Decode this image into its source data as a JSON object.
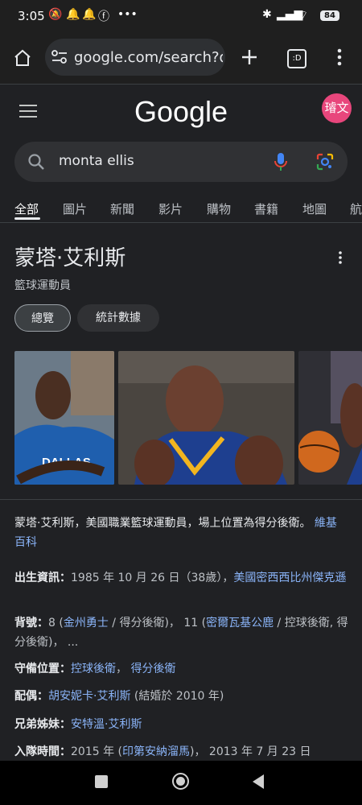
{
  "status_bar": {
    "time": "3:05",
    "battery": "84"
  },
  "browser": {
    "url": "google.com/search?q",
    "tab_count": ":D"
  },
  "google": {
    "logo": "Google",
    "avatar": "璿文",
    "query": "monta ellis"
  },
  "nav_tabs": [
    "全部",
    "圖片",
    "新聞",
    "影片",
    "購物",
    "書籍",
    "地圖",
    "航"
  ],
  "entity": {
    "title": "蒙塔·艾利斯",
    "subtitle": "籃球運動員",
    "chips": [
      "總覽",
      "統計數據"
    ]
  },
  "description": {
    "text": "蒙塔·艾利斯，美國職業籃球運動員，場上位置為得分後衛。",
    "source": "維基百科"
  },
  "facts": {
    "birth_label": "出生資訊：",
    "birth_date": "1985 年 10 月 26 日（38歲）",
    "birth_place": "美國密西西比州傑克遜",
    "number_label": "背號：",
    "number_a": "8 (",
    "team_a": "金州勇士",
    "number_a_rest": " / 得分後衛)， 11 (",
    "team_b": "密爾瓦基公鹿",
    "number_b_rest": " / 控球後衛, 得分後衛)， ...",
    "position_label": "守備位置：",
    "position_a": "控球後衛",
    "position_b": "得分後衛",
    "spouse_label": "配偶：",
    "spouse": "胡安妮卡·艾利斯",
    "spouse_rest": " (結婚於 2010 年)",
    "sibling_label": "兄弟姊妹：",
    "sibling": "安特溫·艾利斯",
    "join_label": "入隊時間：",
    "join_a": "2015 年 (",
    "join_team": "印第安納溜馬",
    "join_b": ")， 2013 年 7 月 23 日"
  },
  "images": [
    {
      "alt": "Monta Ellis in Dallas warmup"
    },
    {
      "alt": "Monta Ellis in Golden State jersey"
    },
    {
      "alt": "Monta Ellis with basketball"
    }
  ]
}
